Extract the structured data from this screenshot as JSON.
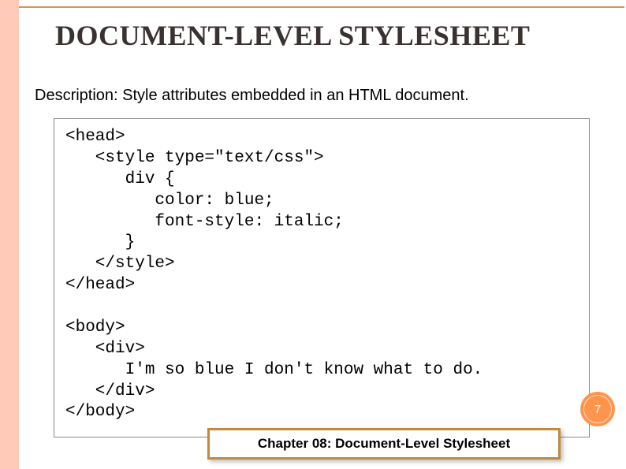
{
  "title": "DOCUMENT-LEVEL STYLESHEET",
  "description": "Description: Style attributes embedded in an HTML document.",
  "code": "<head>\n   <style type=\"text/css\">\n      div {\n         color: blue;\n         font-style: italic;\n      }\n   </style>\n</head>\n\n<body>\n   <div>\n      I'm so blue I don't know what to do.\n   </div>\n</body>",
  "page_number": "7",
  "chapter_label": "Chapter  08: Document-Level Stylesheet"
}
